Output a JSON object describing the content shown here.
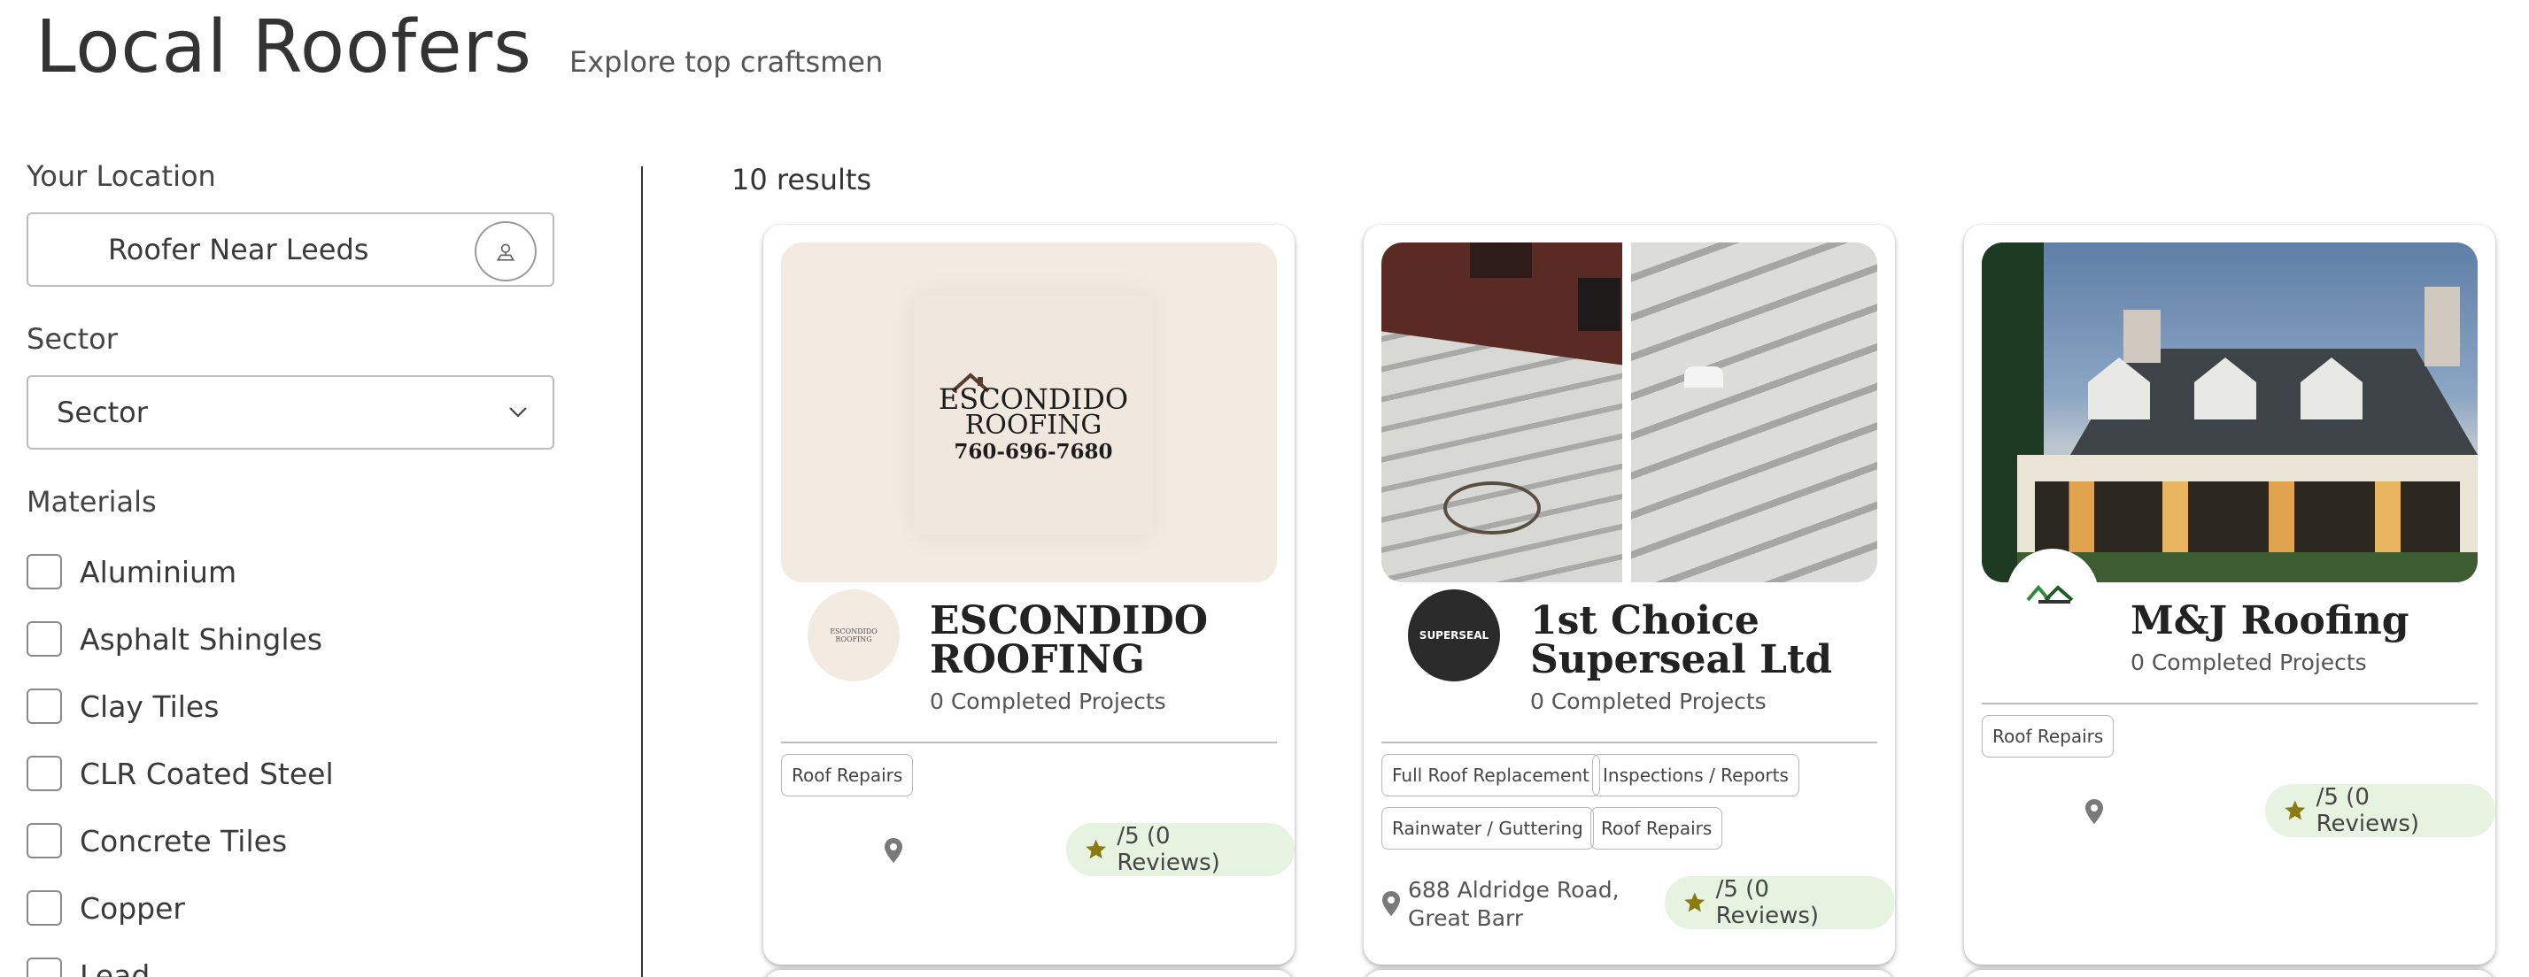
{
  "header": {
    "title": "Local Roofers",
    "subtitle": "Explore top craftsmen"
  },
  "sidebar": {
    "location_label": "Your Location",
    "location_value": "Roofer Near Leeds",
    "sector_label": "Sector",
    "sector_value": "Sector",
    "materials_label": "Materials",
    "materials": [
      "Aluminium",
      "Asphalt Shingles",
      "Clay Tiles",
      "CLR Coated Steel",
      "Concrete Tiles",
      "Copper",
      "Lead"
    ]
  },
  "results": {
    "count_label": "10 results",
    "cards": [
      {
        "name_line1": "ESCONDIDO",
        "name_line2": "ROOFING",
        "projects": "0 Completed Projects",
        "tags": [
          "Roof Repairs"
        ],
        "rating": "/5 (0 Reviews)",
        "logo_text": [
          "ESCONDIDO",
          "ROOFING",
          "760-696-7680"
        ]
      },
      {
        "name_line1": "1st Choice",
        "name_line2": "Superseal Ltd",
        "projects": "0 Completed Projects",
        "tags": [
          "Full Roof Replacement",
          "Inspections / Reports",
          "Rainwater / Guttering",
          "Roof Repairs"
        ],
        "address_line1": "688 Aldridge Road,",
        "address_line2": "Great Barr",
        "rating": "/5 (0 Reviews)",
        "logo_text": "SUPERSEAL"
      },
      {
        "name_line1": "M&J Roofing",
        "projects": "0 Completed Projects",
        "tags": [
          "Roof Repairs"
        ],
        "rating": "/5 (0 Reviews)"
      }
    ]
  },
  "icons": {
    "location_button": "user-location-icon",
    "select_arrow": "chevron-down-icon",
    "pin": "map-pin-icon",
    "star": "star-icon"
  },
  "colors": {
    "rating_bg": "#e6f3e0",
    "star": "#8a7a12"
  }
}
